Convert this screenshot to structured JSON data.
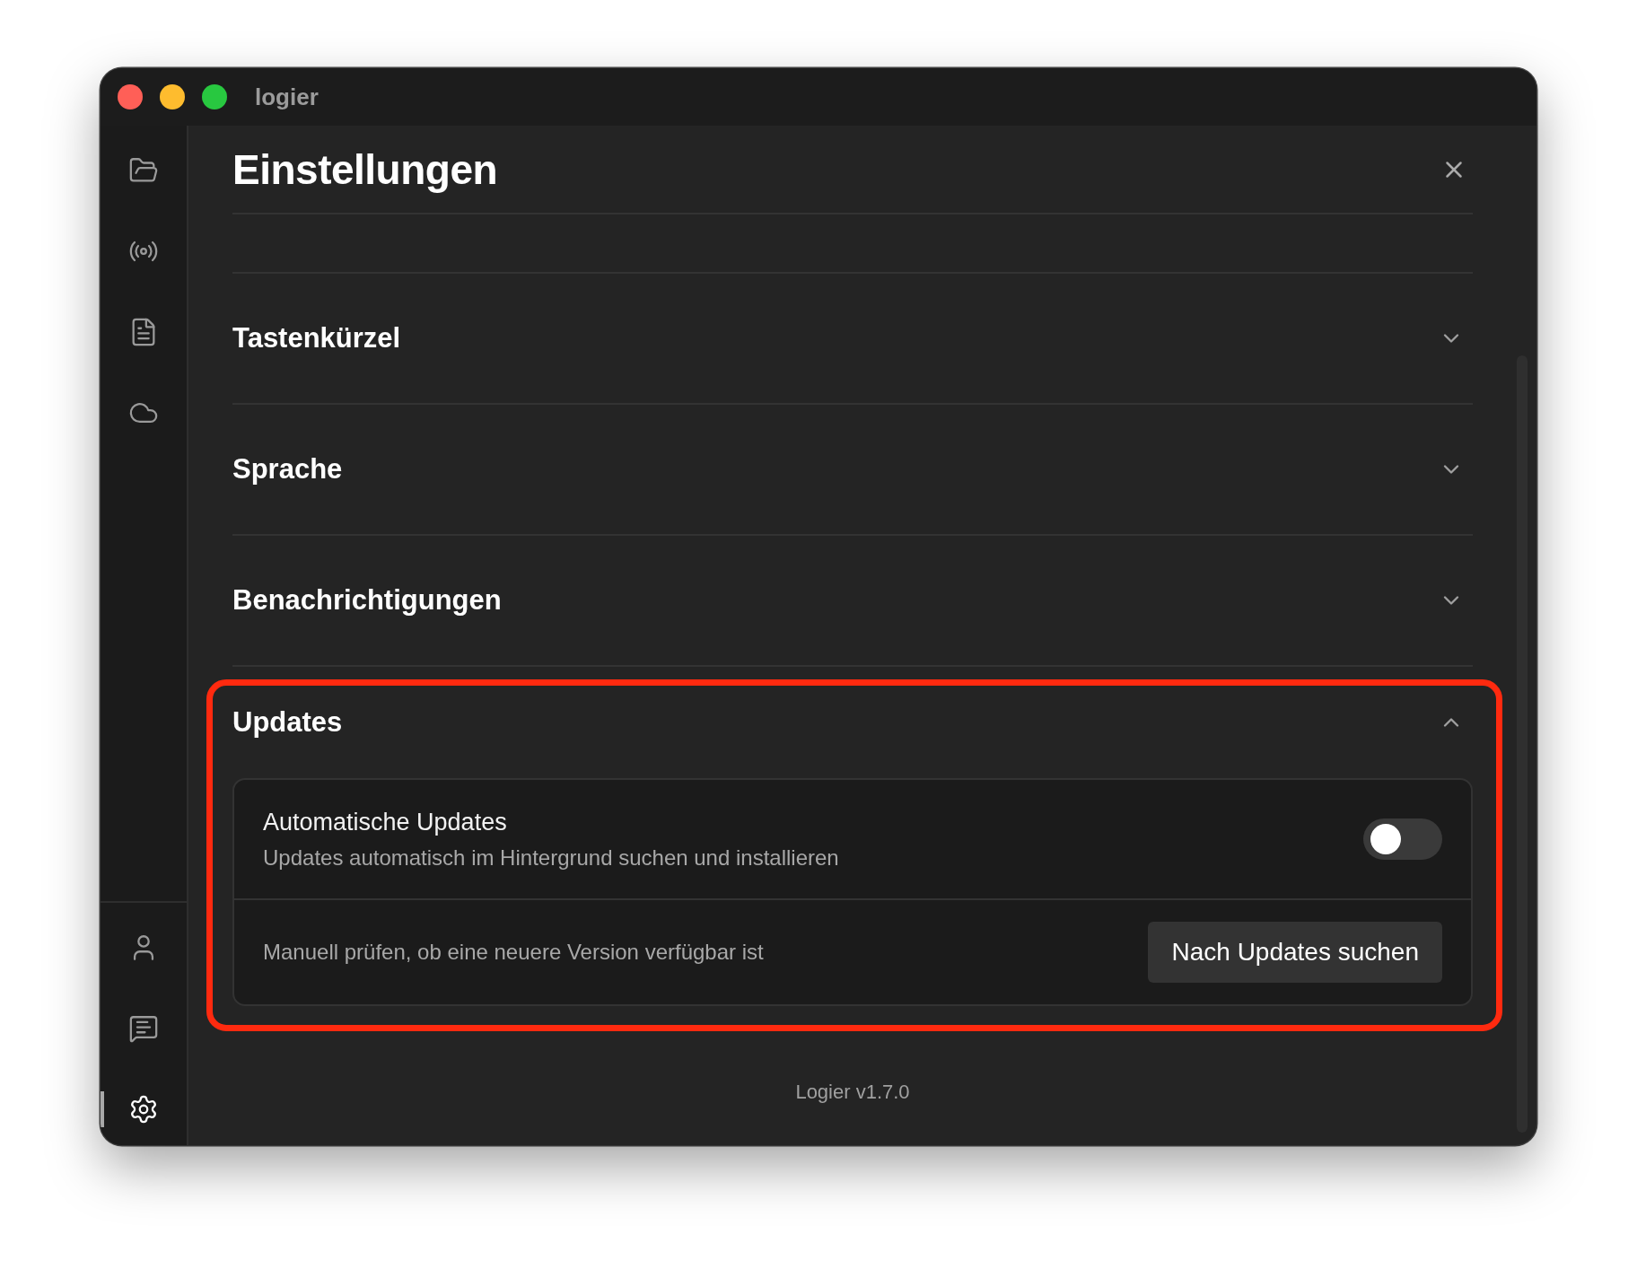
{
  "window": {
    "title": "logier"
  },
  "sidebar": {
    "top_items": [
      {
        "kind": "folder",
        "selected": false
      },
      {
        "kind": "broadcast",
        "selected": false
      },
      {
        "kind": "document",
        "selected": false
      },
      {
        "kind": "cloud",
        "selected": false
      }
    ],
    "bottom_items": [
      {
        "kind": "user",
        "selected": false
      },
      {
        "kind": "message",
        "selected": false
      },
      {
        "kind": "settings",
        "selected": true
      }
    ]
  },
  "settings": {
    "title": "Einstellungen",
    "sections": [
      {
        "title": "Tastenkürzel",
        "expanded": false
      },
      {
        "title": "Sprache",
        "expanded": false
      },
      {
        "title": "Benachrichtigungen",
        "expanded": false
      },
      {
        "title": "Updates",
        "expanded": true,
        "highlighted": true,
        "auto_update": {
          "label": "Automatische Updates",
          "description": "Updates automatisch im Hintergrund suchen und installieren",
          "on": false
        },
        "manual_check": {
          "description": "Manuell prüfen, ob eine neuere Version verfügbar ist",
          "button": "Nach Updates suchen"
        }
      }
    ]
  },
  "footer": {
    "version": "Logier v1.7.0"
  }
}
